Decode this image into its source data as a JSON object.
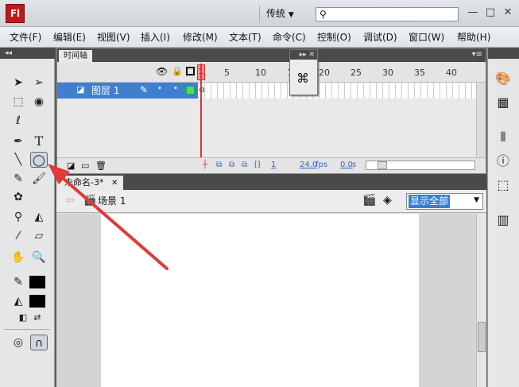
{
  "app": {
    "logo_text": "Fl",
    "workspace": "传统",
    "workspace_arrow": "▼",
    "search_placeholder": "",
    "window_controls": [
      "—",
      "□",
      "✕"
    ]
  },
  "menu": [
    "文件(F)",
    "编辑(E)",
    "视图(V)",
    "插入(I)",
    "修改(M)",
    "文本(T)",
    "命令(C)",
    "控制(O)",
    "调试(D)",
    "窗口(W)",
    "帮助(H)"
  ],
  "tools": {
    "header": "◂◂",
    "icons": [
      "selection-tool",
      "subselection-tool",
      "free-transform-tool",
      "3d-rotation-tool",
      "lasso-tool",
      "pen-tool",
      "text-tool",
      "line-tool",
      "oval-tool",
      "pencil-tool",
      "brush-tool",
      "deco-tool",
      "bone-tool",
      "paint-bucket-tool",
      "eyedropper-tool",
      "eraser-tool",
      "hand-tool",
      "zoom-tool",
      "stroke-color",
      "fill-color",
      "swap-colors",
      "object-drawing",
      "snap-to-objects"
    ],
    "selected": "oval-tool"
  },
  "timeline": {
    "tab": "时间轴",
    "frame_numbers": [
      "1",
      "5",
      "10",
      "15",
      "20",
      "25",
      "30",
      "35",
      "40"
    ],
    "layer": {
      "name": "图层 1"
    },
    "current_frame": "1",
    "fps": "24.0",
    "fps_unit": "fps",
    "time": "0.0",
    "time_unit": "s"
  },
  "popup": {
    "header": "▸▸ ✕"
  },
  "document": {
    "tab_title": "未命名-3*",
    "tab_close": "✕",
    "scene": "场景 1",
    "zoom": "显示全部",
    "zoom_arrow": "▼"
  },
  "colors": {
    "accent": "#3f7fd0",
    "arrow": "#e03a3a",
    "logo": "#c4161c"
  }
}
